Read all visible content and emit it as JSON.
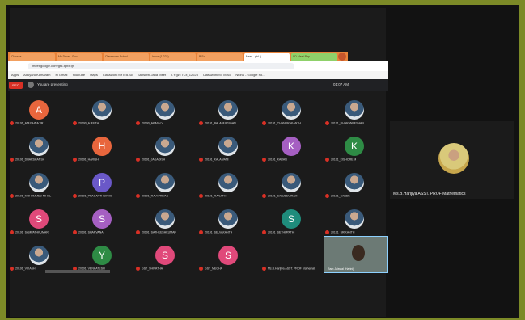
{
  "browser": {
    "tabs": [
      {
        "label": "Classes",
        "style": "normal"
      },
      {
        "label": "My Drive - Goo",
        "style": "normal"
      },
      {
        "label": "Classroom Sched",
        "style": "normal"
      },
      {
        "label": "Inbox (1,222)",
        "style": "normal"
      },
      {
        "label": "B.Sc",
        "style": "normal"
      },
      {
        "label": "Meet - gtd-tj...",
        "style": "active"
      },
      {
        "label": "SD Meet Rep...",
        "style": "green"
      }
    ],
    "url": "meet.google.com/gtd-tpnx-tjf",
    "bookmarks": [
      "Apps",
      "Aduyaru Kamaram",
      "M Gmail",
      "YouTube",
      "Maps",
      "Classwork for II B.Sc",
      "Sanskriti Jana Meet",
      "T.Y.gzTTCx_12223",
      "Classwork for M.Sc",
      "Nfon4 - Google Fo..."
    ]
  },
  "meet": {
    "recording_badge": "REC",
    "presenting_text": "You are presenting",
    "clock": "01:07 AM",
    "participants": [
      {
        "name": "20191_ANUSHNA VR",
        "initial": "A",
        "color": "#e8663d",
        "photo": false
      },
      {
        "name": "20190_AJEETH",
        "initial": "",
        "color": "",
        "photo": true
      },
      {
        "name": "20190_AKASH V",
        "initial": "",
        "color": "",
        "photo": true
      },
      {
        "name": "20191_BALAMURUGAN",
        "initial": "",
        "color": "",
        "photo": true
      },
      {
        "name": "20191_CHANDRAKANTH",
        "initial": "",
        "color": "",
        "photo": true
      },
      {
        "name": "20191_DHARANEESHAN",
        "initial": "",
        "color": "",
        "photo": true
      },
      {
        "name": "20191_DHARSHANSH",
        "initial": "",
        "color": "",
        "photo": true
      },
      {
        "name": "20191_HARISH",
        "initial": "H",
        "color": "#e8663d",
        "photo": false
      },
      {
        "name": "20191_JAGADISH",
        "initial": "",
        "color": "",
        "photo": true
      },
      {
        "name": "20191_KALAIVANI",
        "initial": "",
        "color": "",
        "photo": true
      },
      {
        "name": "20191_KARAN",
        "initial": "K",
        "color": "#a55fc2",
        "photo": false
      },
      {
        "name": "20191_KISHORE M",
        "initial": "K",
        "color": "#2e8b45",
        "photo": false
      },
      {
        "name": "20191_MOHAMMED NIHAL",
        "initial": "",
        "color": "",
        "photo": true
      },
      {
        "name": "20191_PRASANTHNIKHIL",
        "initial": "P",
        "color": "#6a58c8",
        "photo": false
      },
      {
        "name": "20191_RAVI PRIYAN",
        "initial": "",
        "color": "",
        "photo": true
      },
      {
        "name": "20191_RANJITH",
        "initial": "",
        "color": "",
        "photo": true
      },
      {
        "name": "20191_SANJEEVIRAM",
        "initial": "",
        "color": "",
        "photo": true
      },
      {
        "name": "20191_SANDE",
        "initial": "",
        "color": "",
        "photo": true
      },
      {
        "name": "20191_SAMPATHKUMAR",
        "initial": "S",
        "color": "#e0497a",
        "photo": false
      },
      {
        "name": "20191_SHARVANA",
        "initial": "S",
        "color": "#a55fc2",
        "photo": false
      },
      {
        "name": "20191_SATHEESHKUMAR",
        "initial": "",
        "color": "",
        "photo": true
      },
      {
        "name": "20191_SELVAKANTH",
        "initial": "",
        "color": "",
        "photo": true
      },
      {
        "name": "20191_SETHUPATHI",
        "initial": "S",
        "color": "#1f8c7c",
        "photo": false
      },
      {
        "name": "20191_SRIKANTH",
        "initial": "",
        "color": "",
        "photo": true
      },
      {
        "name": "20191_VIKASH",
        "initial": "",
        "color": "",
        "photo": true
      },
      {
        "name": "20191_VENKATESH",
        "initial": "Y",
        "color": "#2e8b45",
        "photo": false
      },
      {
        "name": "GST_SHIVATHA",
        "initial": "S",
        "color": "#e0497a",
        "photo": false
      },
      {
        "name": "GST_MEGHA",
        "initial": "S",
        "color": "#e0497a",
        "photo": false
      },
      {
        "name": "Ms.B.Harijiya ASST. PROF Mathemat.",
        "initial": "",
        "color": "",
        "photo": false,
        "hidden_avatar": true
      }
    ],
    "self_view_label": "Ram Jaiswal (Harini)"
  },
  "speaker": {
    "name": "Ms.B.Harijiya ASST. PROF Mathematics"
  }
}
